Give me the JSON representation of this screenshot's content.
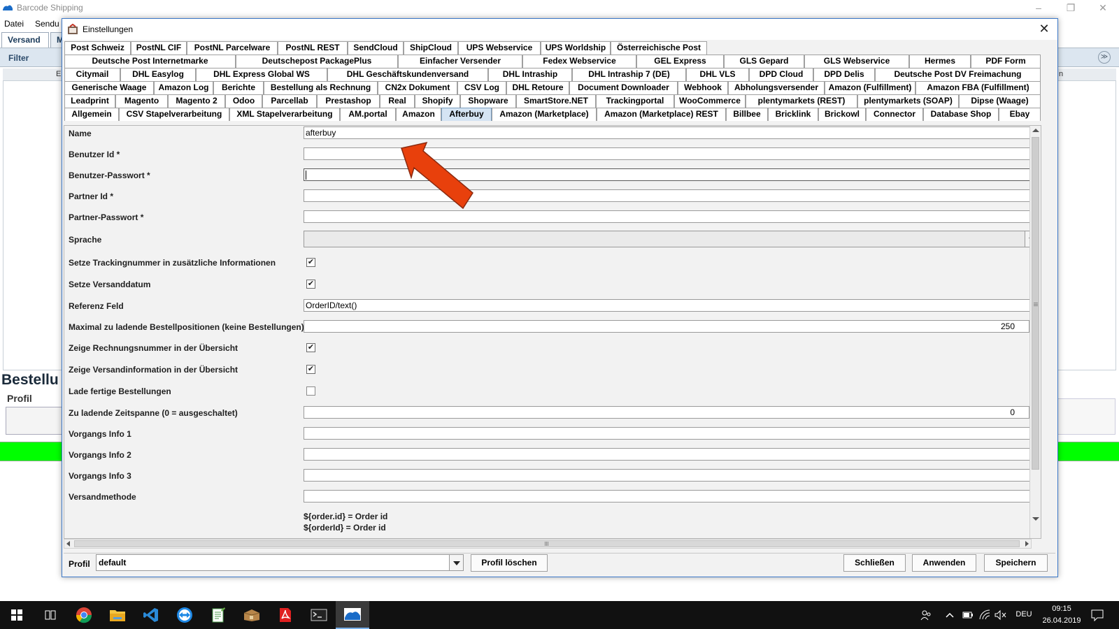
{
  "app": {
    "title": "Barcode Shipping",
    "menu": [
      "Datei",
      "Sendu"
    ],
    "tabs": [
      "Versand",
      "M"
    ],
    "filter_label": "Filter",
    "strip_left": "E",
    "strip_right": "n",
    "bestell_label": "Bestellu",
    "profil_label": "Profil",
    "accent": "#00ff00"
  },
  "dialog": {
    "title": "Einstellungen",
    "tab_rows": [
      [
        "Post Schweiz",
        "PostNL CIF",
        "PostNL Parcelware",
        "PostNL REST",
        "SendCloud",
        "ShipCloud",
        "UPS Webservice",
        "UPS Worldship",
        "Österreichische Post"
      ],
      [
        "Deutsche Post Internetmarke",
        "Deutschepost PackagePlus",
        "Einfacher Versender",
        "Fedex Webservice",
        "GEL Express",
        "GLS Gepard",
        "GLS Webservice",
        "Hermes",
        "PDF Form"
      ],
      [
        "Citymail",
        "DHL Easylog",
        "DHL Express Global WS",
        "DHL Geschäftskundenversand",
        "DHL Intraship",
        "DHL Intraship 7 (DE)",
        "DHL VLS",
        "DPD Cloud",
        "DPD Delis",
        "Deutsche Post DV Freimachung"
      ],
      [
        "Generische Waage",
        "Amazon Log",
        "Berichte",
        "Bestellung als Rechnung",
        "CN2x Dokument",
        "CSV Log",
        "DHL Retoure",
        "Document Downloader",
        "Webhook",
        "Abholungsversender",
        "Amazon (Fulfillment)",
        "Amazon FBA (Fulfillment)"
      ],
      [
        "Leadprint",
        "Magento",
        "Magento 2",
        "Odoo",
        "Parcellab",
        "Prestashop",
        "Real",
        "Shopify",
        "Shopware",
        "SmartStore.NET",
        "Trackingportal",
        "WooCommerce",
        "plentymarkets (REST)",
        "plentymarkets (SOAP)",
        "Dipse (Waage)"
      ],
      [
        "Allgemein",
        "CSV Stapelverarbeitung",
        "XML Stapelverarbeitung",
        "AM.portal",
        "Amazon",
        "Afterbuy",
        "Amazon (Marketplace)",
        "Amazon (Marketplace) REST",
        "Billbee",
        "Bricklink",
        "Brickowl",
        "Connector",
        "Database Shop",
        "Ebay"
      ]
    ],
    "active_tab": "Afterbuy",
    "fields": {
      "name": {
        "label": "Name",
        "value": "afterbuy"
      },
      "benutzer_id": {
        "label": "Benutzer Id *",
        "value": ""
      },
      "benutzer_passwort": {
        "label": "Benutzer-Passwort *",
        "value": ""
      },
      "partner_id": {
        "label": "Partner Id *",
        "value": ""
      },
      "partner_passwort": {
        "label": "Partner-Passwort *",
        "value": ""
      },
      "sprache": {
        "label": "Sprache",
        "value": ""
      },
      "setze_tracking": {
        "label": "Setze Trackingnummer in zusätzliche Informationen",
        "checked": true
      },
      "setze_versanddatum": {
        "label": "Setze Versanddatum",
        "checked": true
      },
      "referenz_feld": {
        "label": "Referenz Feld",
        "value": "OrderID/text()"
      },
      "max_positionen": {
        "label": "Maximal zu ladende Bestellpositionen (keine Bestellungen)",
        "value": "250"
      },
      "zeige_rechnungsnummer": {
        "label": "Zeige Rechnungsnummer in der Übersicht",
        "checked": true
      },
      "zeige_versandinfo": {
        "label": "Zeige Versandinformation in der Übersicht",
        "checked": true
      },
      "lade_fertige": {
        "label": "Lade fertige Bestellungen",
        "checked": false
      },
      "zeitspanne": {
        "label": "Zu ladende Zeitspanne (0 = ausgeschaltet)",
        "value": "0"
      },
      "vorgangs_info_1": {
        "label": "Vorgangs Info 1",
        "value": ""
      },
      "vorgangs_info_2": {
        "label": "Vorgangs Info 2",
        "value": ""
      },
      "vorgangs_info_3": {
        "label": "Vorgangs Info 3",
        "value": ""
      },
      "versandmethode": {
        "label": "Versandmethode",
        "value": ""
      }
    },
    "hints": [
      "${order.id} = Order id",
      "${orderId} = Order id"
    ],
    "bottom": {
      "profil_label": "Profil",
      "profil_value": "default",
      "profil_loeschen": "Profil löschen",
      "schliessen": "Schließen",
      "anwenden": "Anwenden",
      "speichern": "Speichern"
    },
    "check_mark": "✔",
    "close_glyph": "✕",
    "arrow_color": "#e8400c"
  },
  "taskbar": {
    "time": "09:15",
    "date": "26.04.2019",
    "lang": "DEU",
    "icons": [
      "start-icon",
      "task-view-icon",
      "chrome-icon",
      "file-explorer-icon",
      "vscode-icon",
      "teamviewer-icon",
      "notepad-icon",
      "package-icon",
      "acrobat-icon",
      "terminal-icon",
      "barcode-shipping-icon"
    ]
  }
}
